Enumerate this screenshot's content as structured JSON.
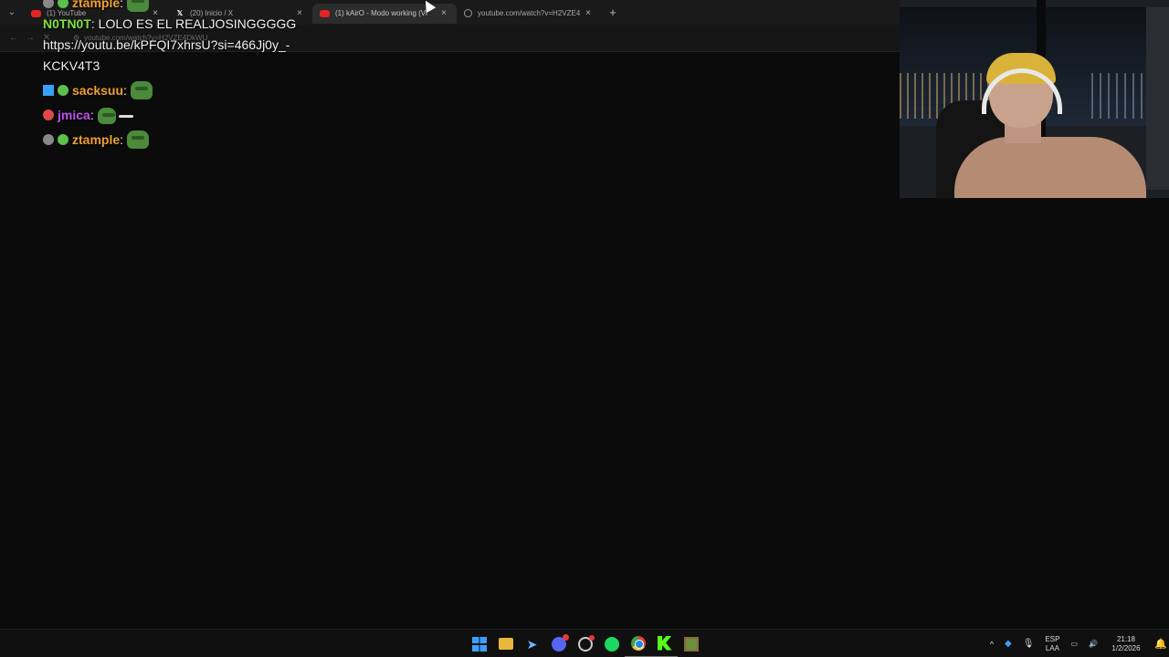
{
  "browser": {
    "tabs": [
      {
        "label": "(1) YouTube",
        "icon": "youtube-icon",
        "active": false
      },
      {
        "label": "(20) Inicio / X",
        "icon": "x-icon",
        "active": false
      },
      {
        "label": "(1) kAirO - Modo working (Vi",
        "icon": "youtube-icon",
        "active": true
      },
      {
        "label": "youtube.com/watch?v=H2VZE4",
        "icon": "globe-icon",
        "active": false
      }
    ],
    "tab_close": "×",
    "new_tab": "+",
    "dropdown": "⌄",
    "back": "←",
    "forward": "→",
    "stop": "✕",
    "url": "youtube.com/watch?v=H2VZE4DkWU"
  },
  "chat": {
    "messages": [
      {
        "user": "ztample",
        "user_color": "#f0a030",
        "text": ": "
      },
      {
        "user": "N0TN0T",
        "user_color": "#7fe03a",
        "text": ": LOLO ES EL REALJOSINGGGGG https://youtu.be/kPFQI7xhrsU?si=466Jj0y_-KCKV4T3"
      },
      {
        "user": "sacksuu",
        "user_color": "#f0a030",
        "text": ": "
      },
      {
        "user": "jmica",
        "user_color": "#c050f0",
        "text": ": "
      },
      {
        "user": "ztample",
        "user_color": "#f0a030",
        "text": ": "
      }
    ]
  },
  "taskbar": {
    "apps": [
      "windows-start-icon",
      "file-explorer-icon",
      "steam-icon",
      "discord-icon",
      "obs-icon",
      "spotify-icon",
      "chrome-icon",
      "kick-icon",
      "minecraft-icon"
    ],
    "tray": {
      "chevron": "^",
      "lang_top": "ESP",
      "lang_bottom": "LAA",
      "time": "21:18",
      "date": "1/2/2026"
    }
  }
}
